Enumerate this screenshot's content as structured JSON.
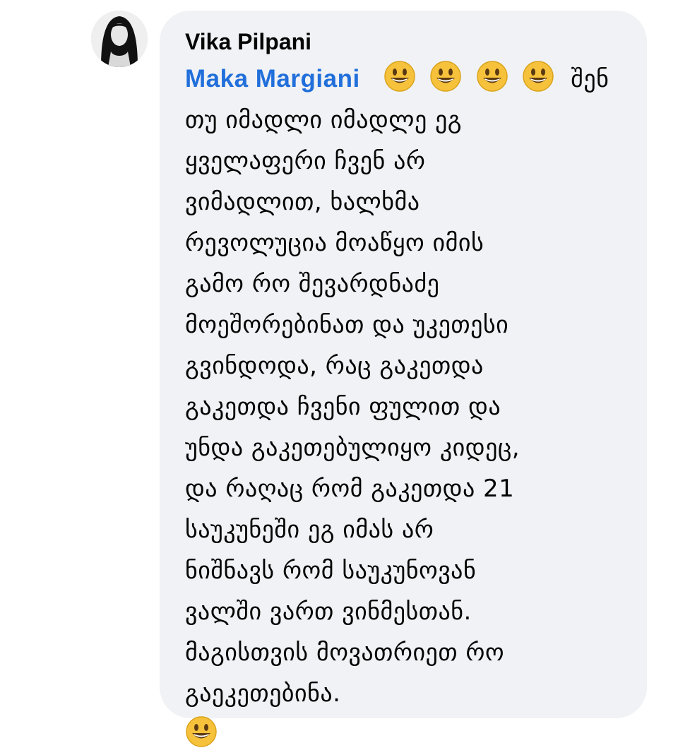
{
  "comment": {
    "author_name": "Vika Pilpani",
    "mention": "Maka Margiani",
    "emoji_icon": "grinning-face-icon",
    "first_line_tail": "შენ",
    "lines": [
      "თუ იმადლი იმადლე ეგ",
      "ყველაფერი ჩვენ არ",
      "ვიმადლით, ხალხმა",
      "რევოლუცია მოაწყო იმის",
      "გამო რო შევარდნაძე",
      "მოეშორებინათ და უკეთესი",
      "გვინდოდა, რაც გაკეთდა",
      "გაკეთდა ჩვენი ფულით და",
      "უნდა გაკეთებულიყო კიდეც,",
      "და რაღაც რომ გაკეთდა 21",
      "საუკუნეში ეგ იმას არ",
      "ნიშნავს რომ საუკუნოვან",
      "ვალში ვართ ვინმესთან.",
      "მაგისთვის მოვათრიეთ რო",
      "გაეკეთებინა."
    ]
  },
  "colors": {
    "bubble": "#f0f2f5",
    "mention": "#216fdb",
    "text": "#050505"
  }
}
